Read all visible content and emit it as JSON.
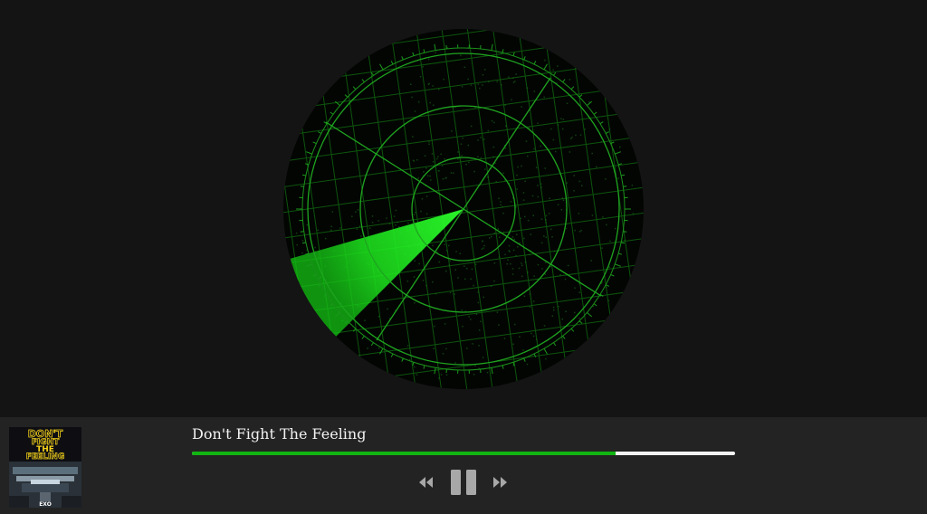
{
  "track": {
    "title": "Don't Fight The Feeling",
    "progress": 0.78
  },
  "album_art": {
    "line1": "DON'T",
    "line2": "FIGHT",
    "line3": "THE",
    "line4": "FEELING",
    "artist": "EXO"
  },
  "controls": {
    "prev_icon": "rewind-icon",
    "pause_icon": "pause-icon",
    "next_icon": "fast-forward-icon"
  },
  "colors": {
    "accent": "#11b511",
    "radar_green": "#22e01c",
    "background": "#141414",
    "bar_background": "#232323"
  }
}
